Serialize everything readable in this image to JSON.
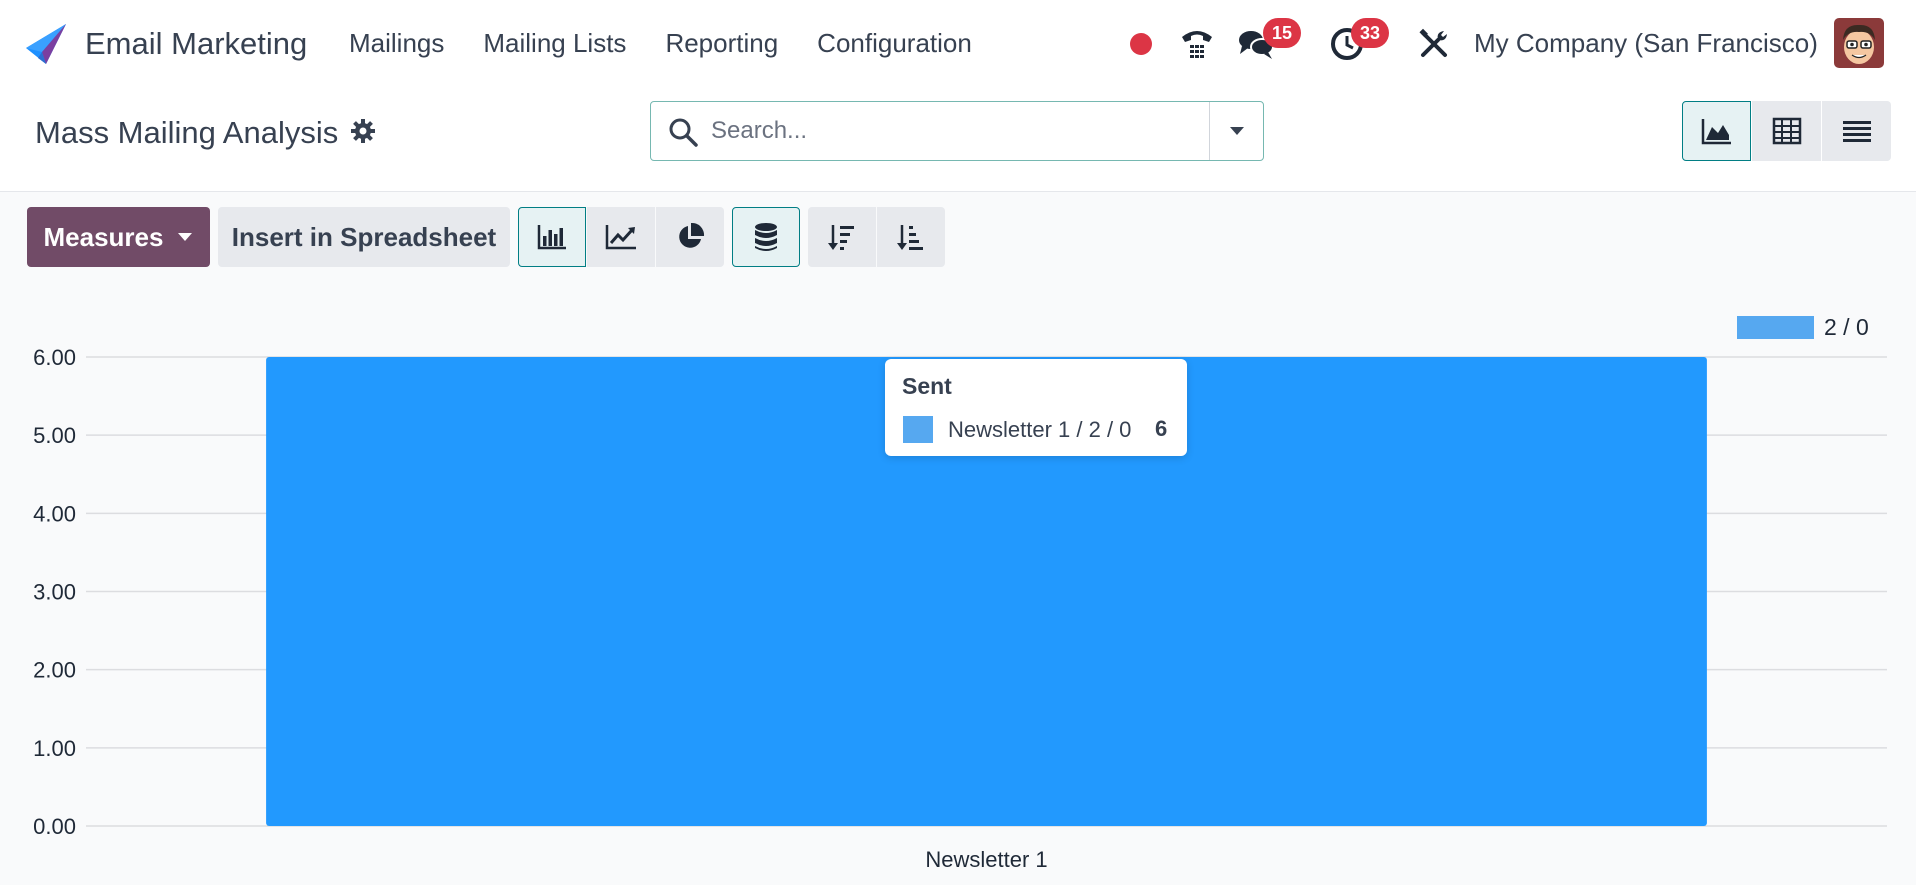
{
  "app": {
    "name": "Email Marketing"
  },
  "nav": {
    "items": [
      "Mailings",
      "Mailing Lists",
      "Reporting",
      "Configuration"
    ]
  },
  "systray": {
    "messages_count": "15",
    "activities_count": "33",
    "company": "My Company (San Francisco)"
  },
  "control_panel": {
    "title": "Mass Mailing Analysis",
    "search_placeholder": "Search..."
  },
  "toolbar": {
    "measures_label": "Measures",
    "spreadsheet_label": "Insert in Spreadsheet"
  },
  "tooltip": {
    "title": "Sent",
    "label": "Newsletter 1 / 2 / 0",
    "value": "6"
  },
  "colors": {
    "bar": "#2299fe",
    "legend": "#56a8f0",
    "accent": "#714b67",
    "teal": "#017e84"
  },
  "chart_data": {
    "type": "bar",
    "categories": [
      "Newsletter 1"
    ],
    "series": [
      {
        "name": "2 / 0",
        "values": [
          6
        ]
      }
    ],
    "ylim": [
      0,
      6
    ],
    "yticks": [
      "0.00",
      "1.00",
      "2.00",
      "3.00",
      "4.00",
      "5.00",
      "6.00"
    ],
    "grid": true,
    "legend": "top-right"
  }
}
